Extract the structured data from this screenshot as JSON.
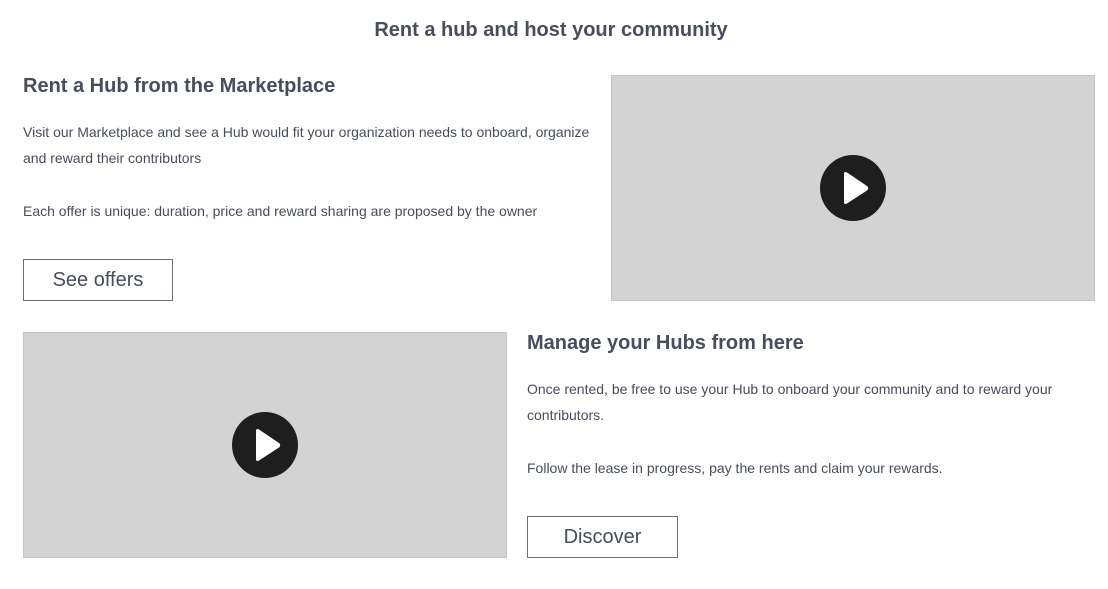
{
  "header": {
    "title": "Rent a hub and host your community"
  },
  "marketplace": {
    "heading": "Rent a Hub from the Marketplace",
    "paragraph_1": "Visit our Marketplace and see a Hub would fit your organization needs to onboard, organize and reward their contributors",
    "paragraph_2": "Each offer is unique: duration, price and reward sharing are proposed by the owner",
    "button_label": "See offers",
    "video_icon": "play-icon"
  },
  "manage": {
    "heading": "Manage your Hubs from here",
    "paragraph_1": "Once rented, be free to use your Hub to onboard your community and to reward your contributors.",
    "paragraph_2": "Follow the lease in progress, pay the rents and claim your rewards.",
    "button_label": "Discover",
    "video_icon": "play-icon"
  },
  "colors": {
    "text": "#474d5c",
    "video_placeholder": "#d3d3d3",
    "play_button": "#1e1e1e"
  }
}
